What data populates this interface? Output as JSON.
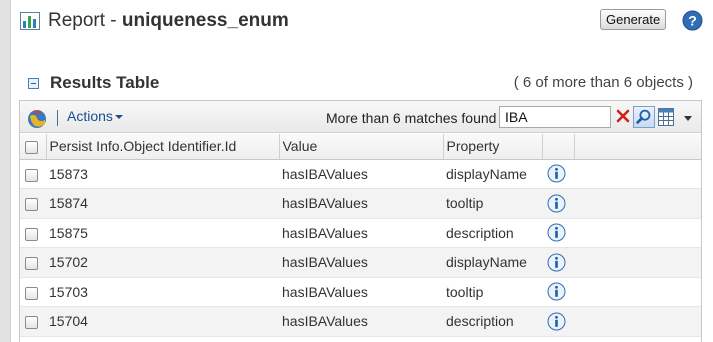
{
  "header": {
    "title_prefix": "Report - ",
    "title_name": "uniqueness_enum",
    "generate_label": "Generate"
  },
  "section": {
    "title": "Results Table",
    "count": "( 6 of more than 6 objects )"
  },
  "toolbar": {
    "actions_label": "Actions",
    "matches_text": "More than 6 matches found",
    "search_value": "IBA"
  },
  "table": {
    "columns": [
      "Persist Info.Object Identifier.Id",
      "Value",
      "Property"
    ],
    "rows": [
      {
        "id": "15873",
        "value": "hasIBAValues",
        "property": "displayName"
      },
      {
        "id": "15874",
        "value": "hasIBAValues",
        "property": "tooltip"
      },
      {
        "id": "15875",
        "value": "hasIBAValues",
        "property": "description"
      },
      {
        "id": "15702",
        "value": "hasIBAValues",
        "property": "displayName"
      },
      {
        "id": "15703",
        "value": "hasIBAValues",
        "property": "tooltip"
      },
      {
        "id": "15704",
        "value": "hasIBAValues",
        "property": "description"
      }
    ]
  },
  "icons": {
    "report": "bar-chart-icon",
    "help": "help-icon",
    "collapse": "collapse-icon",
    "globe": "globe-icon",
    "clear": "clear-icon",
    "search": "search-icon",
    "grid": "table-view-icon",
    "info": "info-icon"
  },
  "colors": {
    "link": "#1a4f8f",
    "accent_blue": "#3a6fb0",
    "clear_red": "#d0201a",
    "row_alt": "#f3f3f3"
  }
}
